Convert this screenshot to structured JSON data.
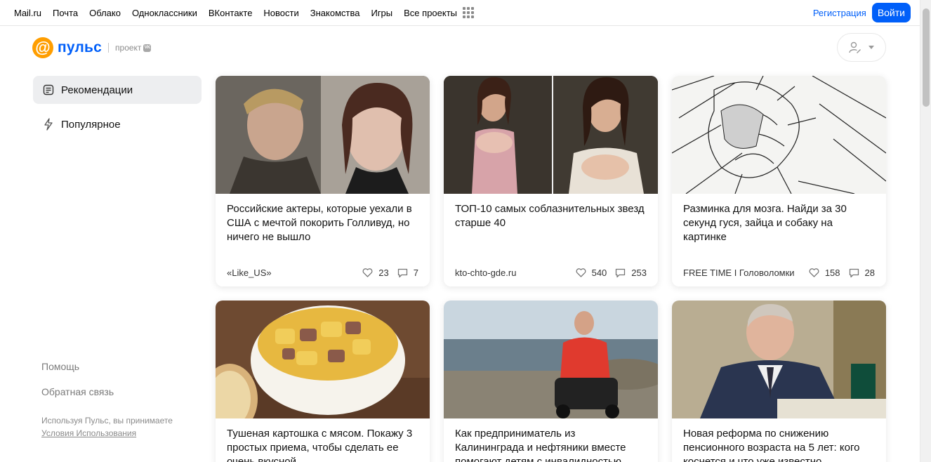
{
  "topnav": {
    "links": [
      "Mail.ru",
      "Почта",
      "Облако",
      "Одноклассники",
      "ВКонтакте",
      "Новости",
      "Знакомства",
      "Игры",
      "Все проекты"
    ],
    "register": "Регистрация",
    "login": "Войти"
  },
  "logo": {
    "name": "пульс",
    "project": "проект"
  },
  "sidebar": {
    "items": [
      {
        "label": "Рекомендации",
        "icon": "document-icon",
        "active": true
      },
      {
        "label": "Популярное",
        "icon": "lightning-icon",
        "active": false
      }
    ],
    "help": "Помощь",
    "feedback": "Обратная связь",
    "terms_text": "Используя Пульс, вы принимаете",
    "terms_link": "Условия Использования"
  },
  "cards": [
    {
      "title": "Российские актеры, которые уехали в США с мечтой покорить Голливуд, но ничего не вышло",
      "source": "«Like_US»",
      "likes": "23",
      "comments": "7"
    },
    {
      "title": "ТОП-10 самых соблазнительных звезд старше 40",
      "source": "kto-chto-gde.ru",
      "likes": "540",
      "comments": "253"
    },
    {
      "title": "Разминка для мозга. Найди за 30 секунд гуся, зайца и собаку на картинке",
      "source": "FREE TIME I Головоломки",
      "likes": "158",
      "comments": "28"
    },
    {
      "title": "Тушеная картошка с мясом. Покажу 3 простых приема, чтобы сделать ее очень вкусной"
    },
    {
      "title": "Как предприниматель из Калининграда и нефтяники вместе помогают детям с инвалидностью"
    },
    {
      "title": "Новая реформа по снижению пенсионного возраста на 5 лет: кого коснется и что уже известно"
    }
  ],
  "colors": {
    "accent": "#005ff9",
    "logo_orange": "#ff9e00",
    "active_bg": "#edeef0"
  }
}
